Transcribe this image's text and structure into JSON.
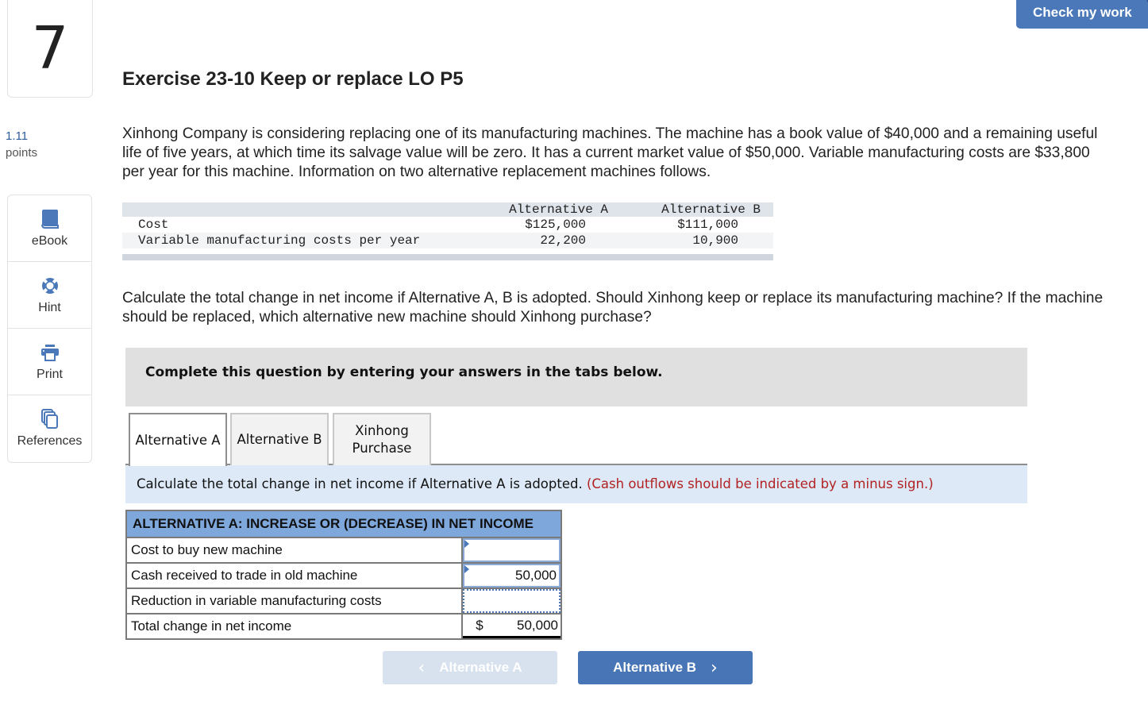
{
  "question": {
    "number": "7",
    "points_value": "1.11",
    "points_label": "points"
  },
  "header": {
    "check_button": "Check my work"
  },
  "sidebar": {
    "items": [
      {
        "label": "eBook",
        "icon": "book-icon"
      },
      {
        "label": "Hint",
        "icon": "lifebuoy-icon"
      },
      {
        "label": "Print",
        "icon": "printer-icon"
      },
      {
        "label": "References",
        "icon": "copies-icon"
      }
    ]
  },
  "exercise": {
    "title": "Exercise 23-10 Keep or replace LO P5",
    "intro": "Xinhong Company is considering replacing one of its manufacturing machines. The machine has a book value of $40,000 and a remaining useful life of five years, at which time its salvage value will be zero. It has a current market value of $50,000. Variable manufacturing costs are $33,800 per year for this machine. Information on two alternative replacement machines follows.",
    "given_table": {
      "headers": [
        "",
        "Alternative A",
        "Alternative B"
      ],
      "rows": [
        [
          "Cost",
          "$125,000",
          "$111,000"
        ],
        [
          "Variable manufacturing costs per year",
          "22,200",
          "10,900"
        ]
      ]
    },
    "prompt": "Calculate the total change in net income if Alternative A, B is adopted. Should Xinhong keep or replace its manufacturing machine? If the machine should be replaced, which alternative new machine should Xinhong purchase?"
  },
  "instructions": "Complete this question by entering your answers in the tabs below.",
  "tabs": [
    {
      "label": "Alternative A",
      "active": true
    },
    {
      "label": "Alternative B",
      "active": false
    },
    {
      "label": "Xinhong Purchase",
      "active": false
    }
  ],
  "tab_content": {
    "instruction": "Calculate the total change in net income if Alternative A is adopted.",
    "instruction_note": "(Cash outflows should be indicated by a minus sign.)",
    "table": {
      "header": "ALTERNATIVE A: INCREASE OR (DECREASE) IN NET INCOME",
      "rows": [
        {
          "label": "Cost to buy new machine",
          "value": ""
        },
        {
          "label": "Cash received to trade in old machine",
          "value": "50,000"
        },
        {
          "label": "Reduction in variable manufacturing costs",
          "value": ""
        },
        {
          "label": "Total change in net income",
          "currency": "$",
          "value": "50,000"
        }
      ]
    }
  },
  "navigation": {
    "prev_label": "Alternative A",
    "next_label": "Alternative B"
  },
  "colors": {
    "accent": "#4a78b8",
    "table_header": "#7ea7dc",
    "note_red": "#b22222"
  }
}
